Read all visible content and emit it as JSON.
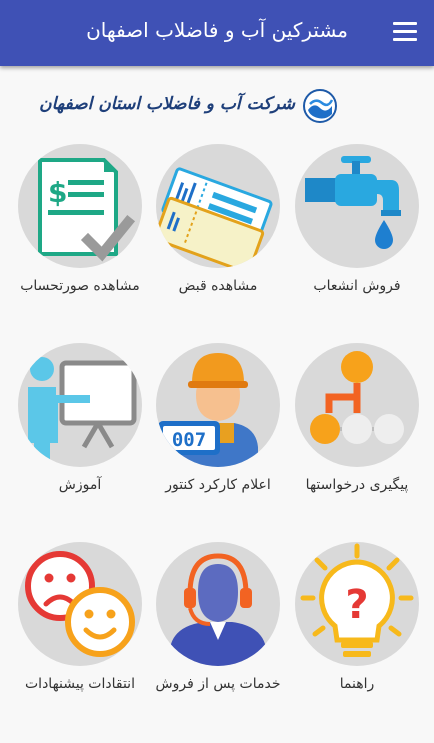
{
  "app_bar": {
    "title": "مشترکین آب و فاضلاب اصفهان",
    "menu_icon": "hamburger-menu-icon",
    "background": "#3f51b5"
  },
  "brand": {
    "text": "شرکت آب و فاضلاب استان اصفهان",
    "logo_icon": "water-drop-logo-icon"
  },
  "menu": {
    "items": [
      {
        "label": "فروش انشعاب",
        "icon": "water-tap-icon"
      },
      {
        "label": "مشاهده قبض",
        "icon": "bill-tickets-icon"
      },
      {
        "label": "مشاهده صورتحساب",
        "icon": "invoice-check-icon"
      },
      {
        "label": "پیگیری درخواستها",
        "icon": "request-tracking-icon"
      },
      {
        "label": "اعلام کارکرد کنتور",
        "icon": "meter-reader-icon"
      },
      {
        "label": "آموزش",
        "icon": "teacher-board-icon"
      },
      {
        "label": "راهنما",
        "icon": "help-lightbulb-icon"
      },
      {
        "label": "خدمات پس از فروش",
        "icon": "support-headset-icon"
      },
      {
        "label": "انتقادات پیشنهادات",
        "icon": "feedback-faces-icon"
      }
    ],
    "meter_digits": "007"
  }
}
